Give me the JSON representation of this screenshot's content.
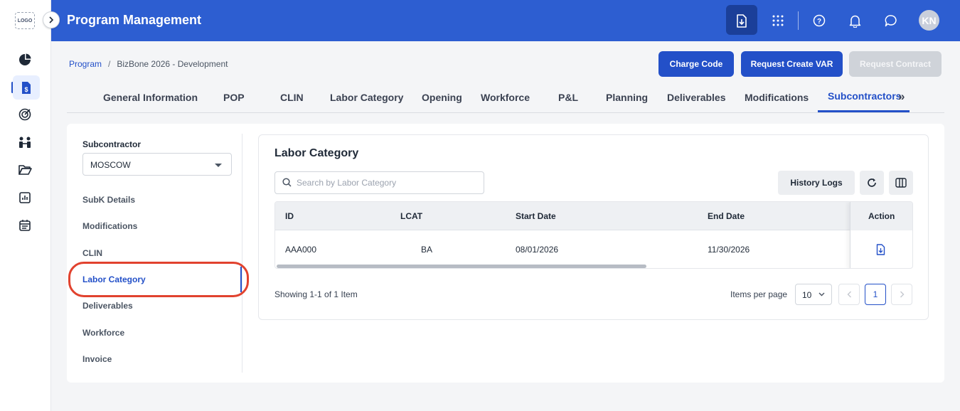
{
  "app": {
    "title": "Program Management",
    "logo_text": "LOGO",
    "user_initials": "KN"
  },
  "breadcrumb": {
    "root": "Program",
    "separator": "/",
    "current": "BizBone 2026 - Development"
  },
  "actions": {
    "charge_code": "Charge Code",
    "request_var": "Request Create VAR",
    "request_contract": "Request Contract"
  },
  "tabs": [
    {
      "label": "General Information"
    },
    {
      "label": "POP"
    },
    {
      "label": "CLIN"
    },
    {
      "label": "Labor Category"
    },
    {
      "label": "Opening"
    },
    {
      "label": "Workforce"
    },
    {
      "label": "P&L"
    },
    {
      "label": "Planning"
    },
    {
      "label": "Deliverables"
    },
    {
      "label": "Modifications"
    },
    {
      "label": "Subcontractors"
    }
  ],
  "tabs_more": "»",
  "subcontractor": {
    "label": "Subcontractor",
    "selected": "MOSCOW",
    "menu": [
      {
        "label": "SubK Details"
      },
      {
        "label": "Modifications"
      },
      {
        "label": "CLIN"
      },
      {
        "label": "Labor Category"
      },
      {
        "label": "Deliverables"
      },
      {
        "label": "Workforce"
      },
      {
        "label": "Invoice"
      }
    ]
  },
  "panel": {
    "title": "Labor Category",
    "search_placeholder": "Search by Labor Category",
    "history_logs": "History Logs"
  },
  "table": {
    "columns": {
      "id": "ID",
      "lcat": "LCAT",
      "start_date": "Start Date",
      "end_date": "End Date",
      "action": "Action"
    },
    "rows": [
      {
        "id": "AAA000",
        "lcat": "BA",
        "start_date": "08/01/2026",
        "end_date": "11/30/2026"
      }
    ]
  },
  "pagination": {
    "showing": "Showing 1-1 of 1 Item",
    "items_per_page_label": "Items per page",
    "items_per_page": "10",
    "current_page": "1"
  },
  "colors": {
    "primary": "#2350c8",
    "header_bg": "#2d5ed1",
    "highlight": "#e1422e"
  }
}
